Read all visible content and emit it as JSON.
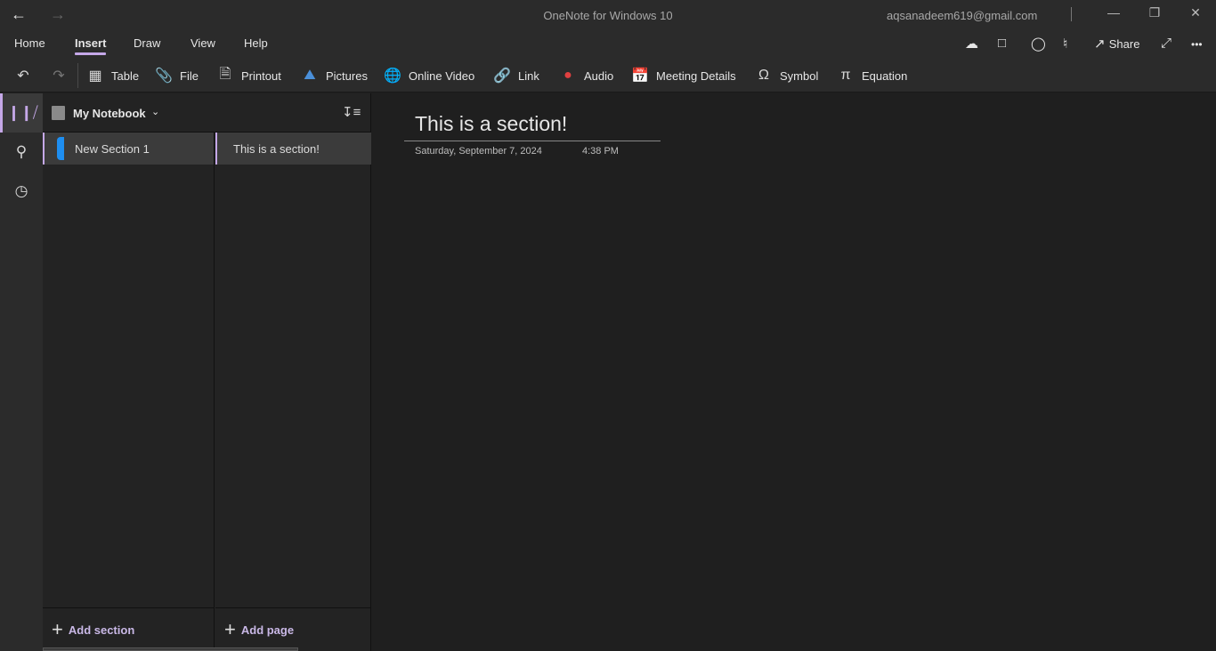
{
  "titlebar": {
    "back_icon": "arrow-left-icon",
    "forward_icon": "arrow-right-icon",
    "app_title": "OneNote for Windows 10",
    "account": "aqsanadeem619@gmail.com",
    "minimize": "—",
    "restore": "❐",
    "close": "✕"
  },
  "ribbon": {
    "tabs": [
      {
        "label": "Home"
      },
      {
        "label": "Insert",
        "active": true
      },
      {
        "label": "Draw"
      },
      {
        "label": "View"
      },
      {
        "label": "Help"
      }
    ],
    "right": {
      "sync_icon": "cloud-sync-icon",
      "sticky_notes_icon": "sticky-notes-icon",
      "tell_me_icon": "lightbulb-icon",
      "notifications_icon": "bell-icon",
      "share_label": "Share",
      "fullscreen_icon": "expand-icon",
      "more_label": "•••"
    }
  },
  "toolbar": {
    "undo_icon": "undo-icon",
    "redo_icon": "redo-icon",
    "items": [
      {
        "label": "Table",
        "icon": "table-icon"
      },
      {
        "label": "File",
        "icon": "paperclip-icon"
      },
      {
        "label": "Printout",
        "icon": "document-icon"
      },
      {
        "label": "Pictures",
        "icon": "picture-icon"
      },
      {
        "label": "Online Video",
        "icon": "online-video-icon"
      },
      {
        "label": "Link",
        "icon": "link-icon"
      },
      {
        "label": "Audio",
        "icon": "audio-record-icon"
      },
      {
        "label": "Meeting Details",
        "icon": "calendar-icon"
      },
      {
        "label": "Symbol",
        "icon": "omega-icon"
      },
      {
        "label": "Equation",
        "icon": "pi-icon"
      }
    ]
  },
  "rail": {
    "items": [
      {
        "name": "notebooks",
        "icon": "notebooks-icon",
        "active": true
      },
      {
        "name": "search",
        "icon": "search-icon"
      },
      {
        "name": "recent",
        "icon": "clock-icon"
      }
    ]
  },
  "navpane": {
    "notebook_name": "My Notebook",
    "sections": [
      {
        "label": "New Section 1",
        "color": "#1e8ef0"
      }
    ],
    "pages": [
      {
        "label": "This is a section!"
      }
    ],
    "add_section_label": "Add section",
    "add_page_label": "Add page"
  },
  "page": {
    "title": "This is a section!",
    "date": "Saturday, September 7, 2024",
    "time": "4:38 PM"
  },
  "colors": {
    "accent": "#c5a8e8",
    "section_color": "#1e8ef0"
  }
}
